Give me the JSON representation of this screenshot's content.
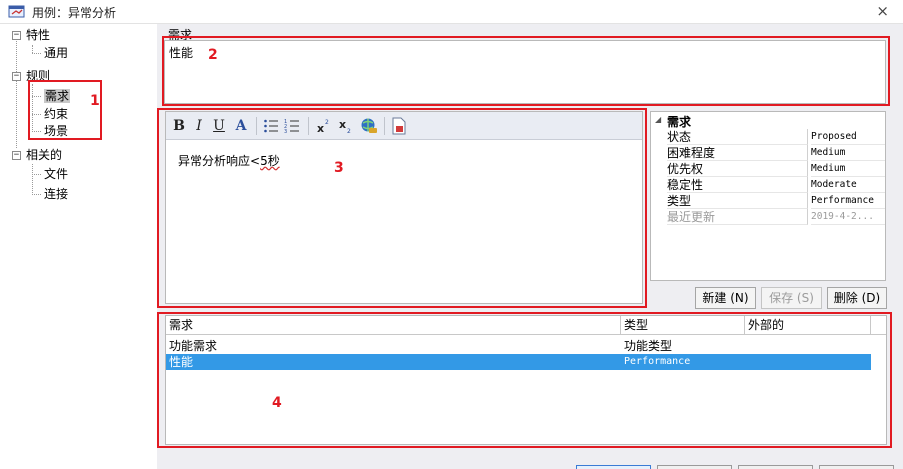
{
  "window": {
    "title": "用例：异常分析"
  },
  "tree": {
    "items": [
      {
        "label": "特性",
        "level": 0
      },
      {
        "label": "通用",
        "level": 1
      },
      {
        "label": "规则",
        "level": 0
      },
      {
        "label": "需求",
        "level": 1,
        "selected": true
      },
      {
        "label": "约束",
        "level": 1
      },
      {
        "label": "场景",
        "level": 1
      },
      {
        "label": "相关的",
        "level": 0
      },
      {
        "label": "文件",
        "level": 1
      },
      {
        "label": "连接",
        "level": 1
      }
    ]
  },
  "requirement": {
    "label": "需求",
    "name_value": "性能"
  },
  "editor": {
    "toolbar": {
      "bold": "B",
      "italic": "I",
      "underline": "U",
      "font_color": "A"
    },
    "text_prefix": "异常分析响应<",
    "text_misspelled": "5秒"
  },
  "properties": {
    "header": "需求",
    "rows": [
      {
        "key": "状态",
        "value": "Proposed"
      },
      {
        "key": "困难程度",
        "value": "Medium"
      },
      {
        "key": "优先权",
        "value": "Medium"
      },
      {
        "key": "稳定性",
        "value": "Moderate"
      },
      {
        "key": "类型",
        "value": "Performance"
      },
      {
        "key": "最近更新",
        "value": "2019-4-2...",
        "dim": true
      }
    ]
  },
  "buttons": {
    "new": "新建 (N)",
    "save": "保存 (S)",
    "delete": "删除 (D)"
  },
  "grid": {
    "columns": [
      "需求",
      "类型",
      "外部的"
    ],
    "rows": [
      {
        "name": "功能需求",
        "type": "功能类型",
        "external": ""
      },
      {
        "name": "性能",
        "type": "Performance",
        "external": "",
        "selected": true
      }
    ]
  },
  "annotations": [
    "1",
    "2",
    "3",
    "4"
  ],
  "colors": {
    "annotation": "#e11a22",
    "selection": "#3399e6"
  }
}
